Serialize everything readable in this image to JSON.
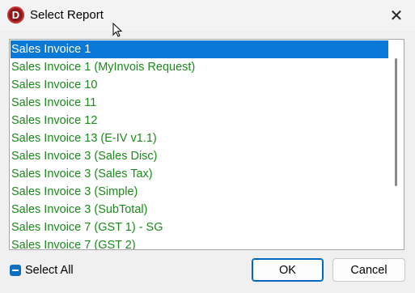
{
  "window": {
    "title": "Select Report",
    "app_icon_letter": "D",
    "close_glyph": "✕"
  },
  "reports": [
    "Sales Invoice 1",
    "Sales Invoice 1 (MyInvois Request)",
    "Sales Invoice 10",
    "Sales Invoice 11",
    "Sales Invoice 12",
    "Sales Invoice 13 (E-IV v1.1)",
    "Sales Invoice 3 (Sales Disc)",
    "Sales Invoice 3 (Sales Tax)",
    "Sales Invoice 3 (Simple)",
    "Sales Invoice 3 (SubTotal)",
    "Sales Invoice 7 (GST 1) - SG",
    "Sales Invoice 7 (GST 2)"
  ],
  "selected_report": "Sales Invoice 1",
  "select_all": {
    "label": "Select All",
    "state": "indeterminate"
  },
  "buttons": {
    "ok": "OK",
    "cancel": "Cancel"
  },
  "colors": {
    "selection": "#0a78d7",
    "item_text": "#1a8a1a",
    "checkbox": "#0a6fc2",
    "app_icon": "#8b1a1a"
  }
}
